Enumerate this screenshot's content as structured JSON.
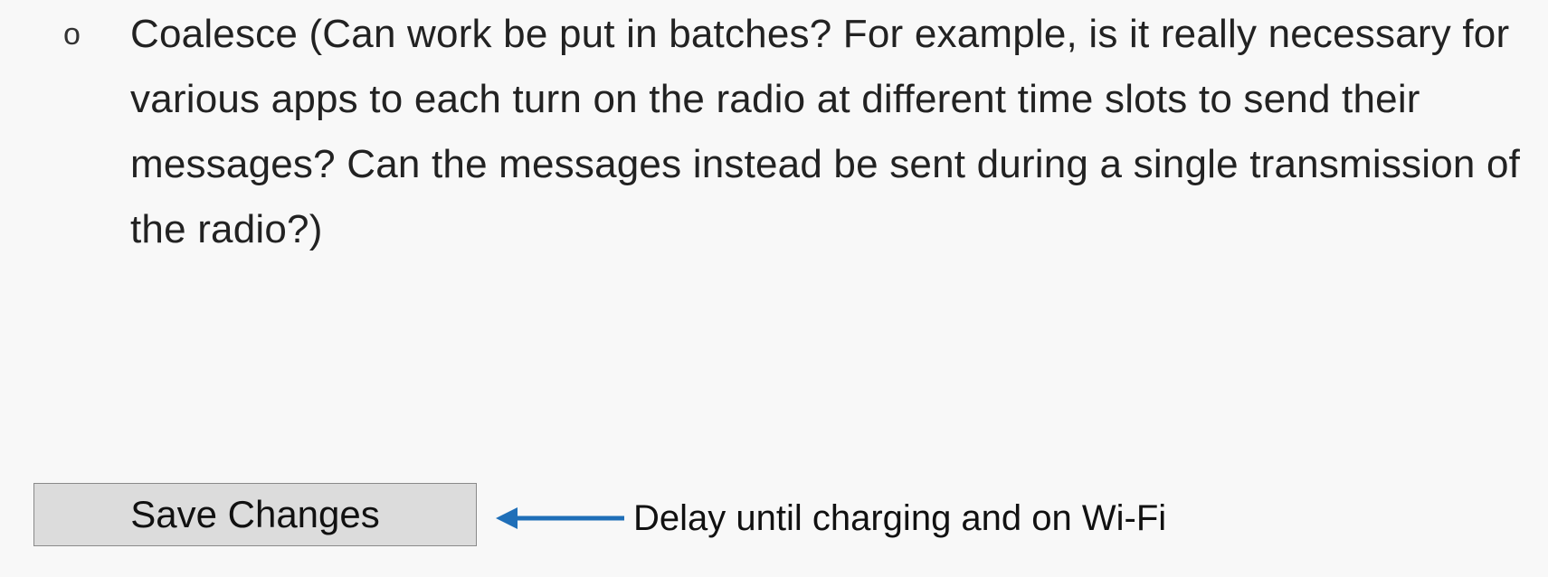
{
  "bullet": {
    "marker": "o",
    "text": "Coalesce (Can work be put in batches? For example, is it really necessary for various apps to each turn on the radio at different time slots to send their messages? Can the messages instead be sent during a single transmission of the radio?)"
  },
  "save_button": {
    "label": "Save Changes"
  },
  "callout": {
    "text": "Delay until charging and on Wi-Fi",
    "arrow_color": "#1f6fb8"
  }
}
